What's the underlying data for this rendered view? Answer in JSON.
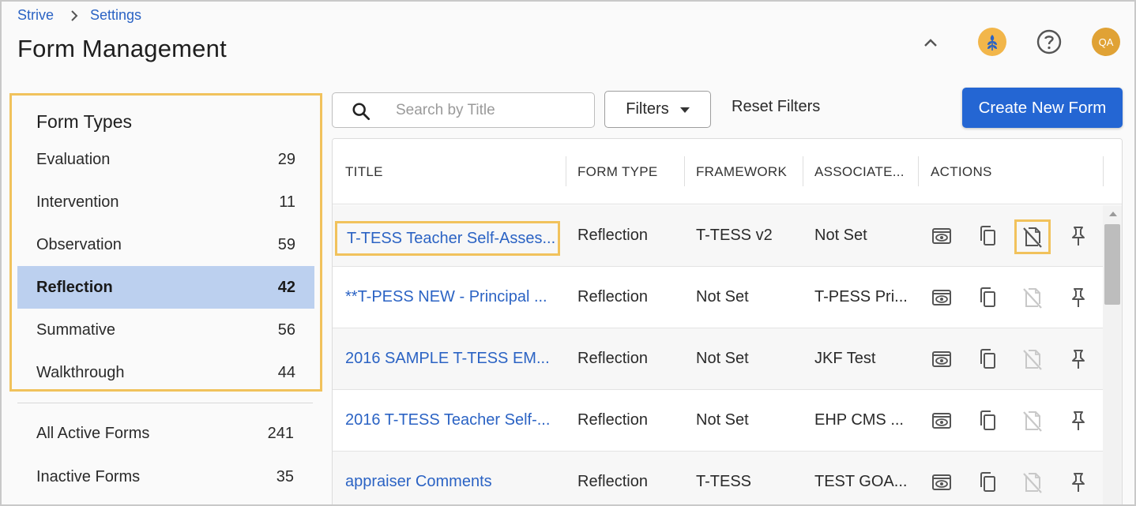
{
  "breadcrumb": {
    "home": "Strive",
    "current": "Settings"
  },
  "page": {
    "title": "Form Management"
  },
  "header": {
    "avatar_initials": "QA",
    "collapse_icon": "chevron-up-icon",
    "help_icon": "help-circle-icon",
    "brand_icon": "wheat-logo-icon"
  },
  "sidebar": {
    "heading": "Form Types",
    "types": [
      {
        "label": "Evaluation",
        "count": "29"
      },
      {
        "label": "Intervention",
        "count": "11"
      },
      {
        "label": "Observation",
        "count": "59"
      },
      {
        "label": "Reflection",
        "count": "42",
        "active": true
      },
      {
        "label": "Summative",
        "count": "56"
      },
      {
        "label": "Walkthrough",
        "count": "44"
      }
    ],
    "other": [
      {
        "label": "All Active Forms",
        "count": "241"
      },
      {
        "label": "Inactive Forms",
        "count": "35"
      }
    ]
  },
  "toolbar": {
    "search_placeholder": "Search by Title",
    "filters_label": "Filters",
    "reset_label": "Reset Filters",
    "create_label": "Create New Form"
  },
  "table": {
    "columns": [
      "TITLE",
      "FORM TYPE",
      "FRAMEWORK",
      "ASSOCIATE...",
      "ACTIONS"
    ],
    "rows": [
      {
        "title": "T-TESS Teacher Self-Asses...",
        "form_type": "Reflection",
        "framework": "T-TESS v2",
        "associated": "Not Set",
        "deactivate_enabled": true
      },
      {
        "title": "**T-PESS NEW - Principal ...",
        "form_type": "Reflection",
        "framework": "Not Set",
        "associated": "T-PESS Pri...",
        "deactivate_enabled": false
      },
      {
        "title": "2016 SAMPLE T-TESS EM...",
        "form_type": "Reflection",
        "framework": "Not Set",
        "associated": "JKF Test",
        "deactivate_enabled": false
      },
      {
        "title": "2016 T-TESS Teacher Self-...",
        "form_type": "Reflection",
        "framework": "Not Set",
        "associated": "EHP CMS ...",
        "deactivate_enabled": false
      },
      {
        "title": "appraiser Comments",
        "form_type": "Reflection",
        "framework": "T-TESS",
        "associated": "TEST GOA...",
        "deactivate_enabled": false
      }
    ]
  },
  "colors": {
    "accent": "#2466d3",
    "link": "#2b63c4",
    "highlight": "#f1c25c",
    "active_bg": "#bcd0ef"
  }
}
